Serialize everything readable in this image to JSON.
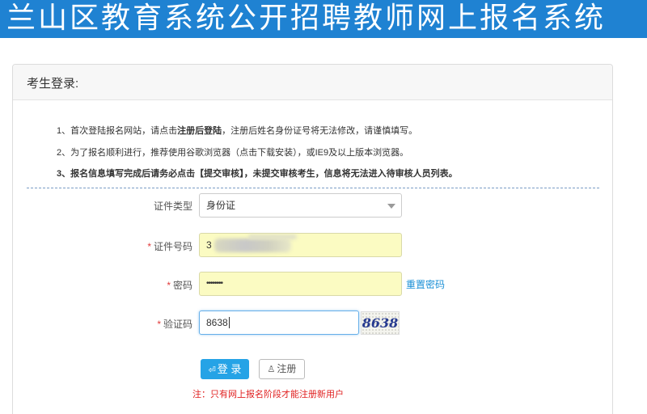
{
  "header": {
    "title": "兰山区教育系统公开招聘教师网上报名系统"
  },
  "panel": {
    "title": "考生登录:"
  },
  "notes": {
    "line1_prefix": "1、首次登陆报名网站，请点击",
    "line1_bold": "注册后登陆",
    "line1_suffix": "，注册后姓名身份证号将无法修改，请谨慎填写。",
    "line2": "2、为了报名顺利进行，推荐使用谷歌浏览器（点击下载安装），或IE9及以上版本浏览器。",
    "line3": "3、报名信息填写完成后请务必点击【提交审核】，未提交审核考生，信息将无法进入待审核人员列表。"
  },
  "form": {
    "id_type": {
      "label": "证件类型",
      "value": "身份证"
    },
    "id_number": {
      "label": "证件号码",
      "required_mark": "*",
      "value": "3"
    },
    "password": {
      "label": "密码",
      "required_mark": "*",
      "value": "••••••••"
    },
    "captcha": {
      "label": "验证码",
      "required_mark": "*",
      "value": "8638",
      "image_text": "8638"
    },
    "reset_password_link": "重置密码"
  },
  "buttons": {
    "login_icon": "⏎",
    "login": "登 录",
    "register_icon": "♙",
    "register": "注册"
  },
  "footer_note": "注：只有网上报名阶段才能注册新用户",
  "colors": {
    "banner": "#1f82d2",
    "accent": "#25a3e6",
    "autofill_yellow": "#fbfbc2",
    "warning_red": "#e02020"
  }
}
